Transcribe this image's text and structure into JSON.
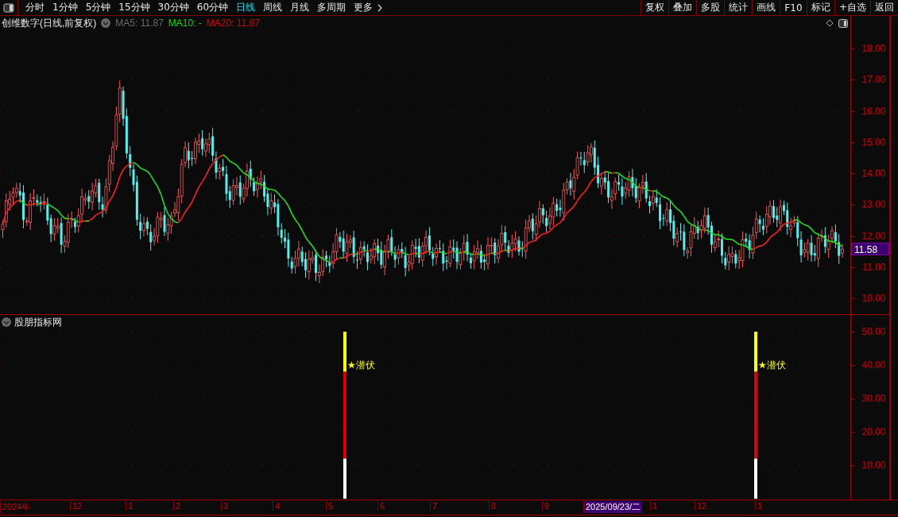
{
  "toolbar": {
    "periods": [
      {
        "label": "分时",
        "selected": false
      },
      {
        "label": "1分钟",
        "selected": false
      },
      {
        "label": "5分钟",
        "selected": false
      },
      {
        "label": "15分钟",
        "selected": false
      },
      {
        "label": "30分钟",
        "selected": false
      },
      {
        "label": "60分钟",
        "selected": false
      },
      {
        "label": "日线",
        "selected": true
      },
      {
        "label": "周线",
        "selected": false
      },
      {
        "label": "月线",
        "selected": false
      },
      {
        "label": "多周期",
        "selected": false
      },
      {
        "label": "更多",
        "selected": false
      }
    ],
    "actions": [
      "复权",
      "叠加",
      "多股",
      "统计",
      "画线",
      "F10",
      "标记",
      "+自选",
      "返回"
    ]
  },
  "chart": {
    "title": "创维数字(日线,前复权)",
    "indicators": [
      {
        "text": "MA5: 11.87",
        "color": "#6a6a6a"
      },
      {
        "text": "MA10: -",
        "color": "#00e000"
      },
      {
        "text": "MA20: 11.87",
        "color": "#e00000"
      }
    ],
    "price_axis": [
      "18.00",
      "17.00",
      "16.00",
      "15.00",
      "14.00",
      "13.00",
      "12.00",
      "11.00",
      "10.00"
    ],
    "last_price": "11.58"
  },
  "indicator_panel": {
    "title": "股朋指标网",
    "axis": [
      "50.00",
      "40.00",
      "30.00",
      "20.00",
      "10.00"
    ],
    "signals": [
      {
        "label": "★潜伏"
      },
      {
        "label": "★潜伏"
      }
    ]
  },
  "date_axis": [
    {
      "label": "2024年",
      "selected": false
    },
    {
      "label": "12",
      "selected": false
    },
    {
      "label": "1",
      "selected": false
    },
    {
      "label": "2",
      "selected": false
    },
    {
      "label": "3",
      "selected": false
    },
    {
      "label": "4",
      "selected": false
    },
    {
      "label": "5",
      "selected": false
    },
    {
      "label": "6",
      "selected": false
    },
    {
      "label": "7",
      "selected": false
    },
    {
      "label": "8",
      "selected": false
    },
    {
      "label": "9",
      "selected": false
    },
    {
      "label": "2025/09/23/二",
      "selected": true
    },
    {
      "label": "1",
      "selected": false
    },
    {
      "label": "12",
      "selected": false
    },
    {
      "label": "1",
      "selected": false
    }
  ]
}
